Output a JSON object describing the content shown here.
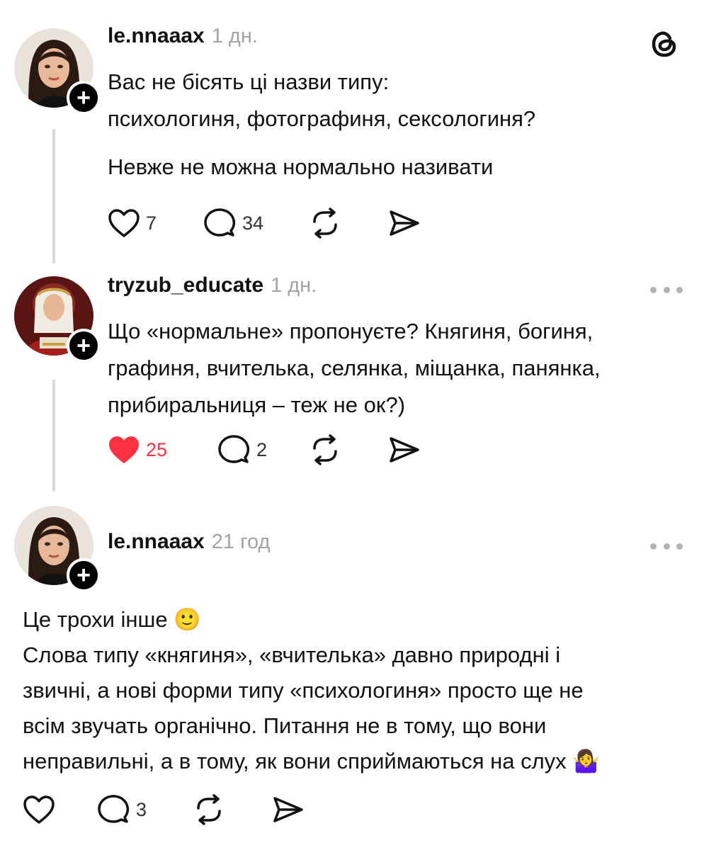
{
  "app": {
    "logo_icon": "threads-logo-icon"
  },
  "colors": {
    "text": "#111111",
    "muted": "#a3a3a3",
    "like_active": "#ff3040",
    "thread_line": "#d9d9d9"
  },
  "posts": [
    {
      "username": "le.nnaaax",
      "time": "1 дн.",
      "lines": [
        "Вас не бісять ці назви типу:",
        "психологиня, фотографиня, сексологиня?",
        "",
        "Невже не можна нормально називати"
      ],
      "likes": "7",
      "replies": "34",
      "liked": false
    },
    {
      "username": "tryzub_educate",
      "time": "1 дн.",
      "lines": [
        "Що «нормальне» пропонуєте? Княгиня, богиня,",
        "графиня, вчителька, селянка, міщанка, панянка,",
        "прибиральниця – теж не ок?)"
      ],
      "likes": "25",
      "replies": "2",
      "liked": true
    },
    {
      "username": "le.nnaaax",
      "time": "21 год",
      "lines": [
        "Це трохи інше 🙂",
        "Слова типу «княгиня», «вчителька» давно природні і",
        "звичні, а  нові форми типу «психологиня» просто ще не",
        "всім звучать органічно. Питання не в тому, що вони",
        "неправильні, а в тому, як вони сприймаються на слух 🤷‍♀️"
      ],
      "likes": "",
      "replies": "3",
      "liked": false
    }
  ]
}
